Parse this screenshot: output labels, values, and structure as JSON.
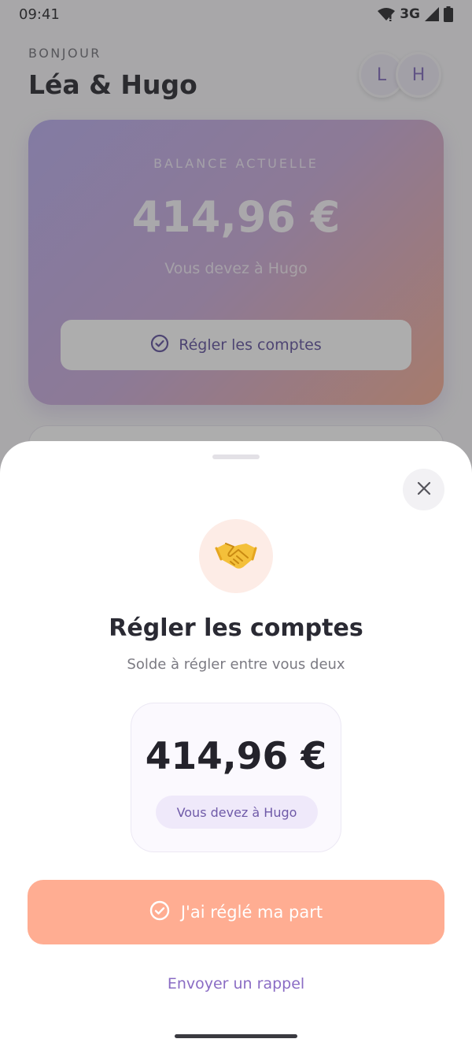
{
  "status_bar": {
    "time": "09:41",
    "network": "3G",
    "icons": [
      "wifi-icon",
      "signal-icon",
      "battery-icon"
    ]
  },
  "header": {
    "greeting": "BONJOUR",
    "names": "Léa & Hugo",
    "avatars": [
      "L",
      "H"
    ]
  },
  "balance_card": {
    "label": "BALANCE ACTUELLE",
    "amount": "414,96 €",
    "subtitle": "Vous devez à Hugo",
    "settle_label": "Régler les comptes",
    "gradient": [
      "#b6a9ee",
      "#f4a98f"
    ]
  },
  "sheet": {
    "emoji": "🤝",
    "title": "Régler les comptes",
    "subtitle": "Solde à régler entre vous deux",
    "amount": "414,96 €",
    "owe_label": "Vous devez à Hugo",
    "primary_label": "J'ai réglé ma part",
    "reminder_label": "Envoyer un rappel",
    "close_icon": "close-icon"
  },
  "colors": {
    "accent_orange": "#ffad92",
    "accent_purple": "#8a6cc4"
  }
}
